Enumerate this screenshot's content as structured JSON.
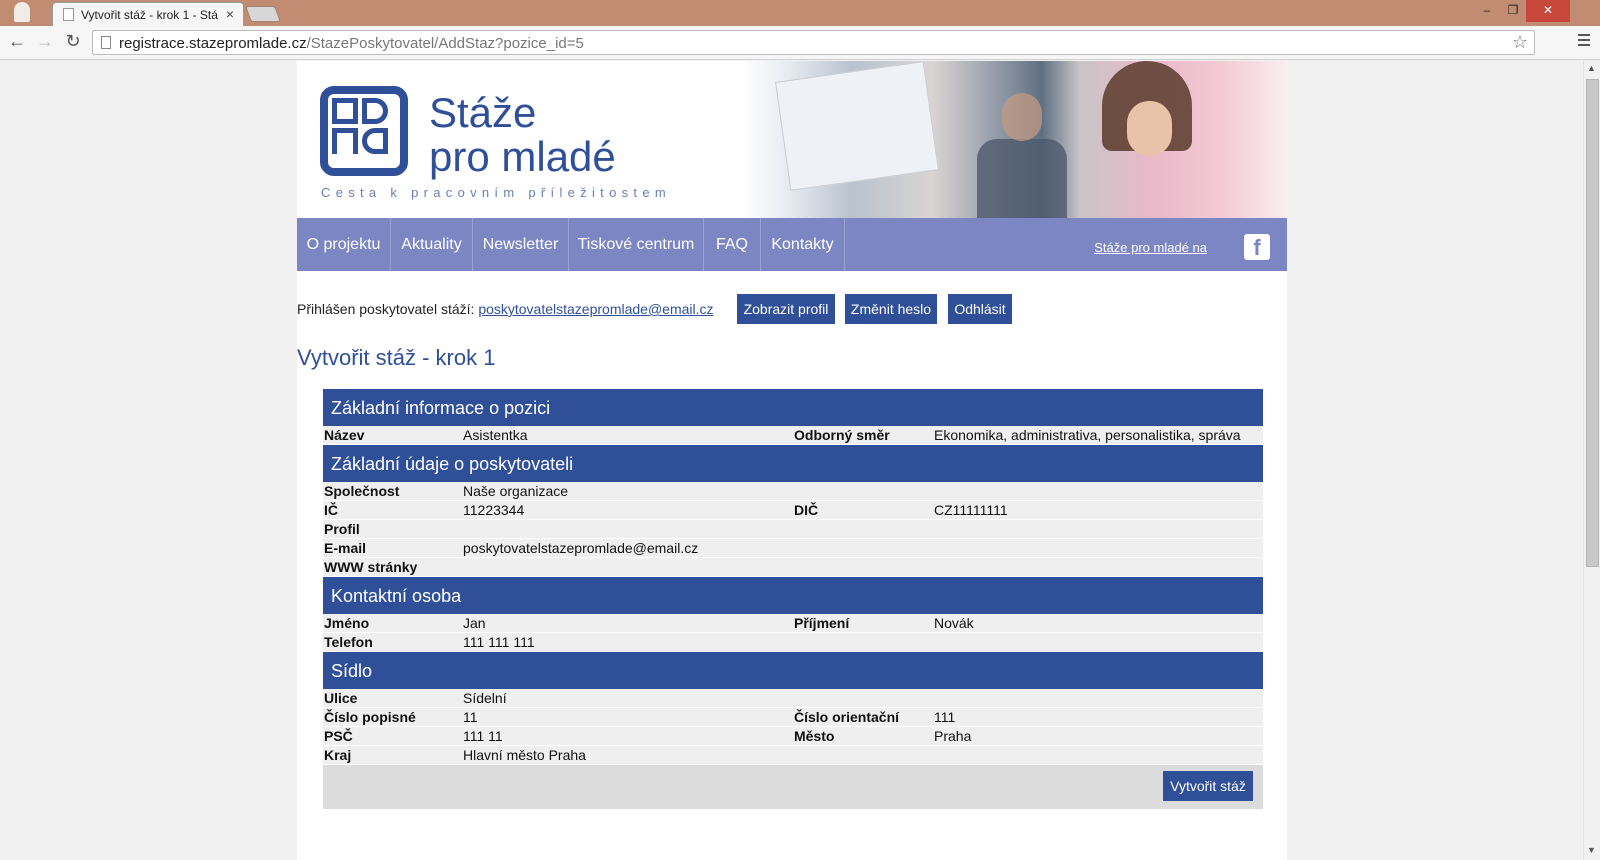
{
  "browser": {
    "tab_title": "Vytvořit stáž - krok 1 - Stá",
    "tab_close": "×",
    "url_host": "registrace.stazepromlade.cz",
    "url_path": "/StazePoskytovatel/AddStaz?pozice_id=5"
  },
  "header": {
    "logo_line1": "Stáže",
    "logo_line2": "pro mladé",
    "logo_tagline": "Cesta k pracovním příležitostem"
  },
  "nav": {
    "items": [
      "O projektu",
      "Aktuality",
      "Newsletter",
      "Tiskové centrum",
      "FAQ",
      "Kontakty"
    ],
    "facebook_text": "Stáže pro mladé na",
    "facebook_icon": "f"
  },
  "login": {
    "prefix": "Přihlášen poskytovatel stáží: ",
    "email": "poskytovatelstazepromlade@email.cz",
    "btn_profile": "Zobrazit profil",
    "btn_password": "Změnit heslo",
    "btn_logout": "Odhlásit"
  },
  "page_title": "Vytvořit stáž - krok 1",
  "sections": {
    "basic": {
      "title": "Základní informace o pozici",
      "rows": [
        {
          "l1": "Název",
          "v1": "Asistentka",
          "l2": "Odborný směr",
          "v2": "Ekonomika, administrativa, personalistika, správa"
        }
      ]
    },
    "provider": {
      "title": "Základní údaje o poskytovateli",
      "rows": [
        {
          "l1": "Společnost",
          "v1": "Naše organizace",
          "l2": "",
          "v2": ""
        },
        {
          "l1": "IČ",
          "v1": "11223344",
          "l2": "DIČ",
          "v2": "CZ11111111"
        },
        {
          "l1": "Profil",
          "v1": "",
          "l2": "",
          "v2": ""
        },
        {
          "l1": "E-mail",
          "v1": "poskytovatelstazepromlade@email.cz",
          "l2": "",
          "v2": ""
        },
        {
          "l1": "WWW stránky",
          "v1": "",
          "l2": "",
          "v2": ""
        }
      ]
    },
    "contact": {
      "title": "Kontaktní osoba",
      "rows": [
        {
          "l1": "Jméno",
          "v1": "Jan",
          "l2": "Příjmení",
          "v2": "Novák"
        },
        {
          "l1": "Telefon",
          "v1": "111 111 111",
          "l2": "",
          "v2": ""
        }
      ]
    },
    "seat": {
      "title": "Sídlo",
      "rows": [
        {
          "l1": "Ulice",
          "v1": "Sídelní",
          "l2": "",
          "v2": ""
        },
        {
          "l1": "Číslo popisné",
          "v1": "11",
          "l2": "Číslo orientační",
          "v2": "111"
        },
        {
          "l1": "PSČ",
          "v1": "111 11",
          "l2": "Město",
          "v2": "Praha"
        },
        {
          "l1": "Kraj",
          "v1": "Hlavní město Praha",
          "l2": "",
          "v2": ""
        }
      ]
    }
  },
  "submit_label": "Vytvořit stáž",
  "colors": {
    "primary": "#2f4f98",
    "nav": "#7b86c2"
  }
}
